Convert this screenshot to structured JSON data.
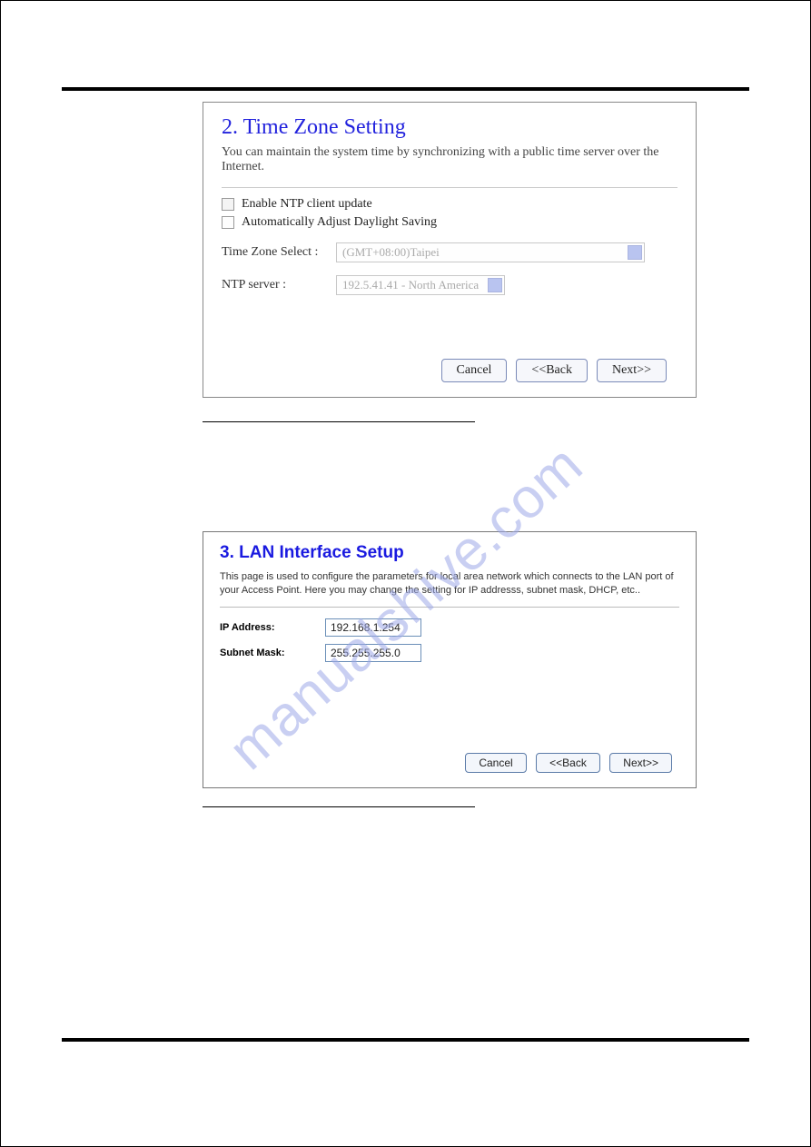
{
  "watermark": "manualshive.com",
  "panel1": {
    "title": "2. Time Zone Setting",
    "description": "You can maintain the system time by synchronizing with a public time server over the Internet.",
    "checkbox1_label": "Enable NTP client update",
    "checkbox2_label": "Automatically Adjust Daylight Saving",
    "tz_label": "Time Zone Select :",
    "tz_value": "(GMT+08:00)Taipei",
    "ntp_label": "NTP server :",
    "ntp_value": "192.5.41.41 - North America",
    "cancel": "Cancel",
    "back": "<<Back",
    "next": "Next>>"
  },
  "panel2": {
    "title": "3. LAN Interface Setup",
    "description": "This page is used to configure the parameters for local area network which connects to the LAN port of your Access Point. Here you may change the setting for IP addresss, subnet mask, DHCP, etc..",
    "ip_label": "IP Address:",
    "ip_value": "192.168.1.254",
    "mask_label": "Subnet Mask:",
    "mask_value": "255.255.255.0",
    "cancel": "Cancel",
    "back": "<<Back",
    "next": "Next>>"
  }
}
